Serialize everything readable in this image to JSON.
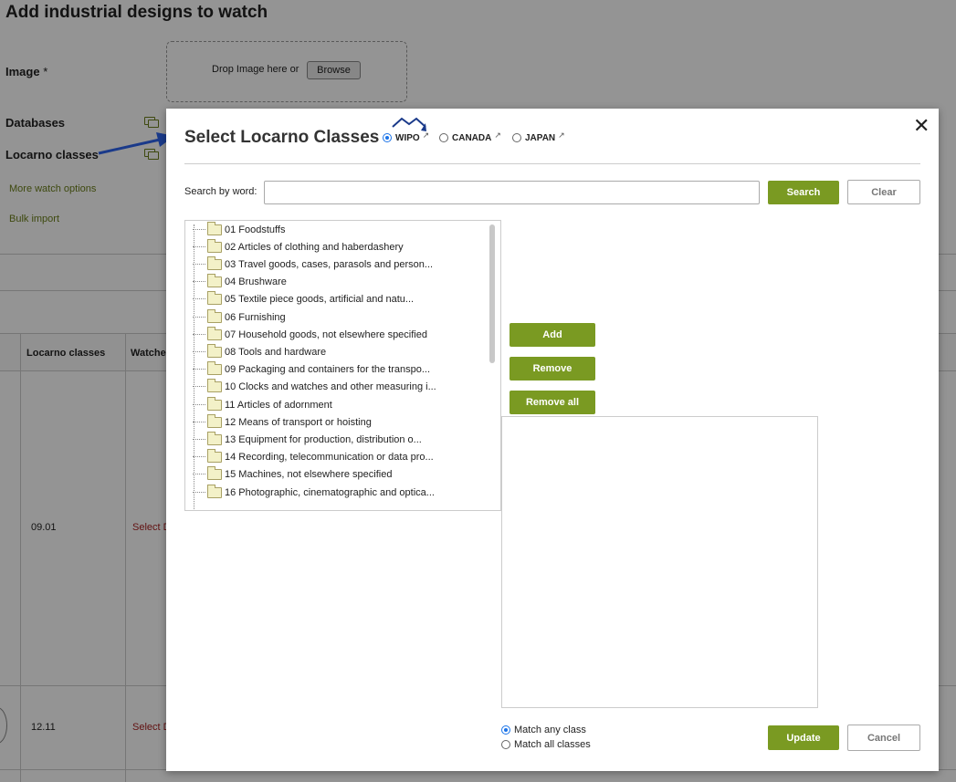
{
  "page": {
    "title": "Add industrial designs to watch",
    "image_label": "Image",
    "required_mark": "*",
    "drop_text": "Drop Image here or",
    "browse_label": "Browse",
    "databases_label": "Databases",
    "locarno_label": "Locarno classes",
    "more_watch_options": "More watch options",
    "bulk_import": "Bulk import",
    "table": {
      "col_locarno": "Locarno classes",
      "col_watches": "Watche",
      "rows": [
        {
          "locarno": "09.01",
          "watch": "Select D"
        },
        {
          "locarno": "12.11",
          "watch": "Select D"
        }
      ]
    }
  },
  "modal": {
    "title": "Select Locarno Classes",
    "close_symbol": "✕",
    "sources": [
      {
        "label": "WIPO",
        "checked": true
      },
      {
        "label": "CANADA",
        "checked": false
      },
      {
        "label": "JAPAN",
        "checked": false
      }
    ],
    "ext_symbol": "↗",
    "search_label": "Search by word:",
    "search_value": "",
    "search_button": "Search",
    "clear_button": "Clear",
    "tree_items": [
      "01 Foodstuffs",
      "02 Articles of clothing and haberdashery",
      "03 Travel goods, cases, parasols and person...",
      "04 Brushware",
      "05 Textile piece goods, artificial and natu...",
      "06 Furnishing",
      "07 Household goods, not elsewhere specified",
      "08 Tools and hardware",
      "09 Packaging and containers for the transpo...",
      "10 Clocks and watches and other measuring i...",
      "11 Articles of adornment",
      "12 Means of transport or hoisting",
      "13 Equipment for production, distribution o...",
      "14 Recording, telecommunication or data pro...",
      "15 Machines, not elsewhere specified",
      "16 Photographic, cinematographic and optica..."
    ],
    "add_button": "Add",
    "remove_button": "Remove",
    "remove_all_button": "Remove all",
    "match_options": [
      {
        "label": "Match any class",
        "checked": true
      },
      {
        "label": "Match all classes",
        "checked": false
      }
    ],
    "update_button": "Update",
    "cancel_button": "Cancel"
  },
  "colors": {
    "accent_green": "#7a9a22",
    "link_green": "#6b7f1a",
    "arrow_blue": "#1a3a8a",
    "radio_blue": "#1a73e8"
  }
}
